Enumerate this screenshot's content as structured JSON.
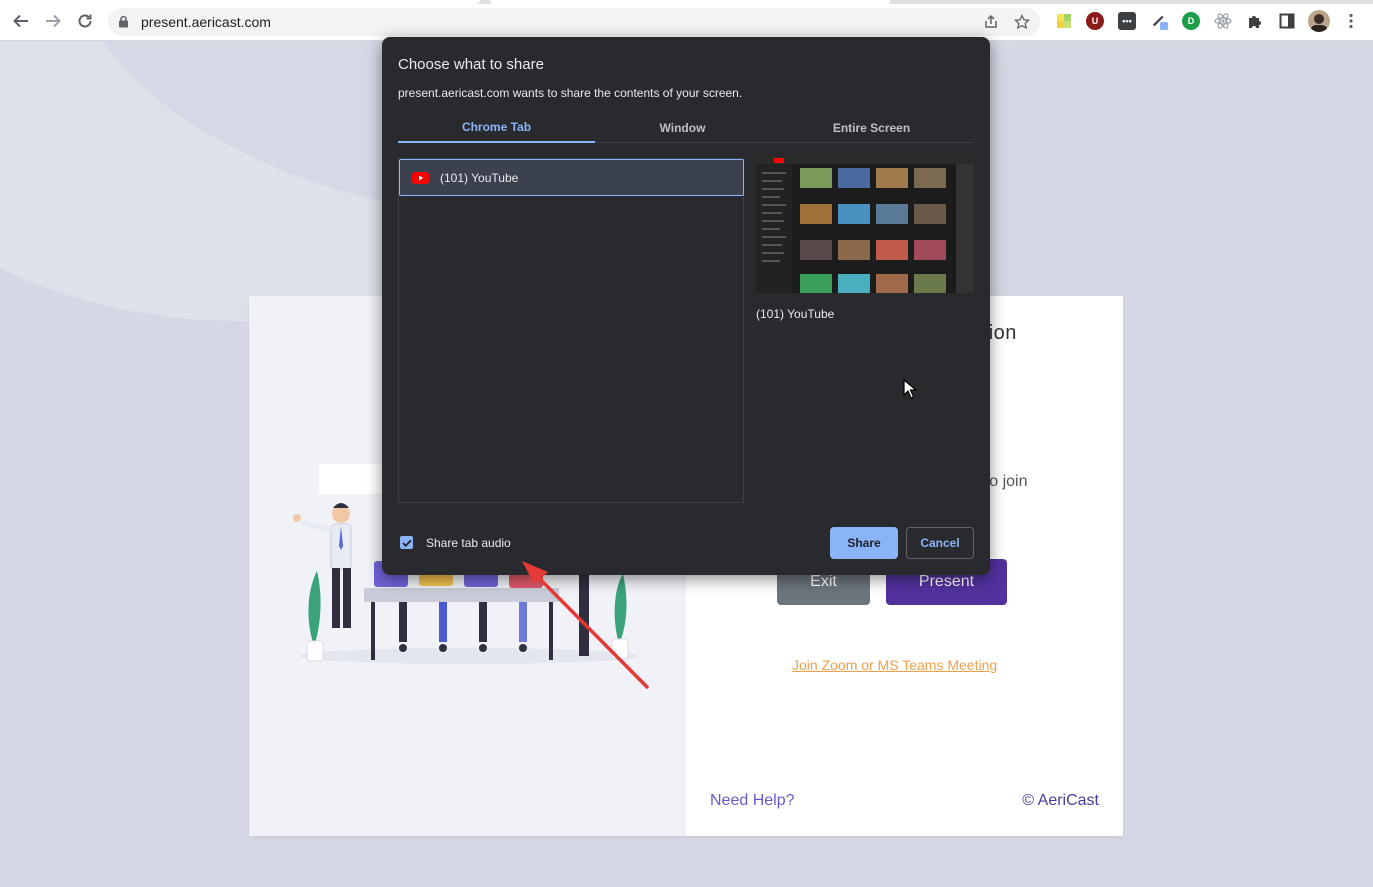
{
  "browser": {
    "url": "present.aericast.com",
    "extensions": [
      "sticky-notes-icon",
      "ublock-icon",
      "dots-extension-icon",
      "color-picker-icon",
      "grammar-extension-icon",
      "react-devtools-icon",
      "puzzle-icon",
      "side-panel-icon",
      "profile-avatar",
      "kebab-menu-icon"
    ],
    "colors": {
      "toolbar": "#ffffff",
      "omnibox": "#f1f3f4"
    }
  },
  "page": {
    "title_partial": "tation",
    "hint_partial": "r to join",
    "exit_label": "Exit",
    "present_label": "Present",
    "join_link": "Join Zoom or MS Teams Meeting",
    "help_link": "Need Help?",
    "copyright": "© AeriCast",
    "colors": {
      "present": "#52329e",
      "exit": "#6c757d",
      "link": "#f0a04b",
      "help": "#6b58cc"
    }
  },
  "dialog": {
    "title": "Choose what to share",
    "subtitle": "present.aericast.com wants to share the contents of your screen.",
    "tabs": [
      {
        "label": "Chrome Tab",
        "active": true
      },
      {
        "label": "Window",
        "active": false
      },
      {
        "label": "Entire Screen",
        "active": false
      }
    ],
    "list": [
      {
        "label": "(101) YouTube",
        "icon": "youtube-icon",
        "selected": true
      }
    ],
    "preview_label": "(101) YouTube",
    "share_audio_label": "Share tab audio",
    "share_audio_checked": true,
    "share_label": "Share",
    "cancel_label": "Cancel",
    "colors": {
      "bg": "#292a2d",
      "accent": "#8ab4f8"
    }
  }
}
